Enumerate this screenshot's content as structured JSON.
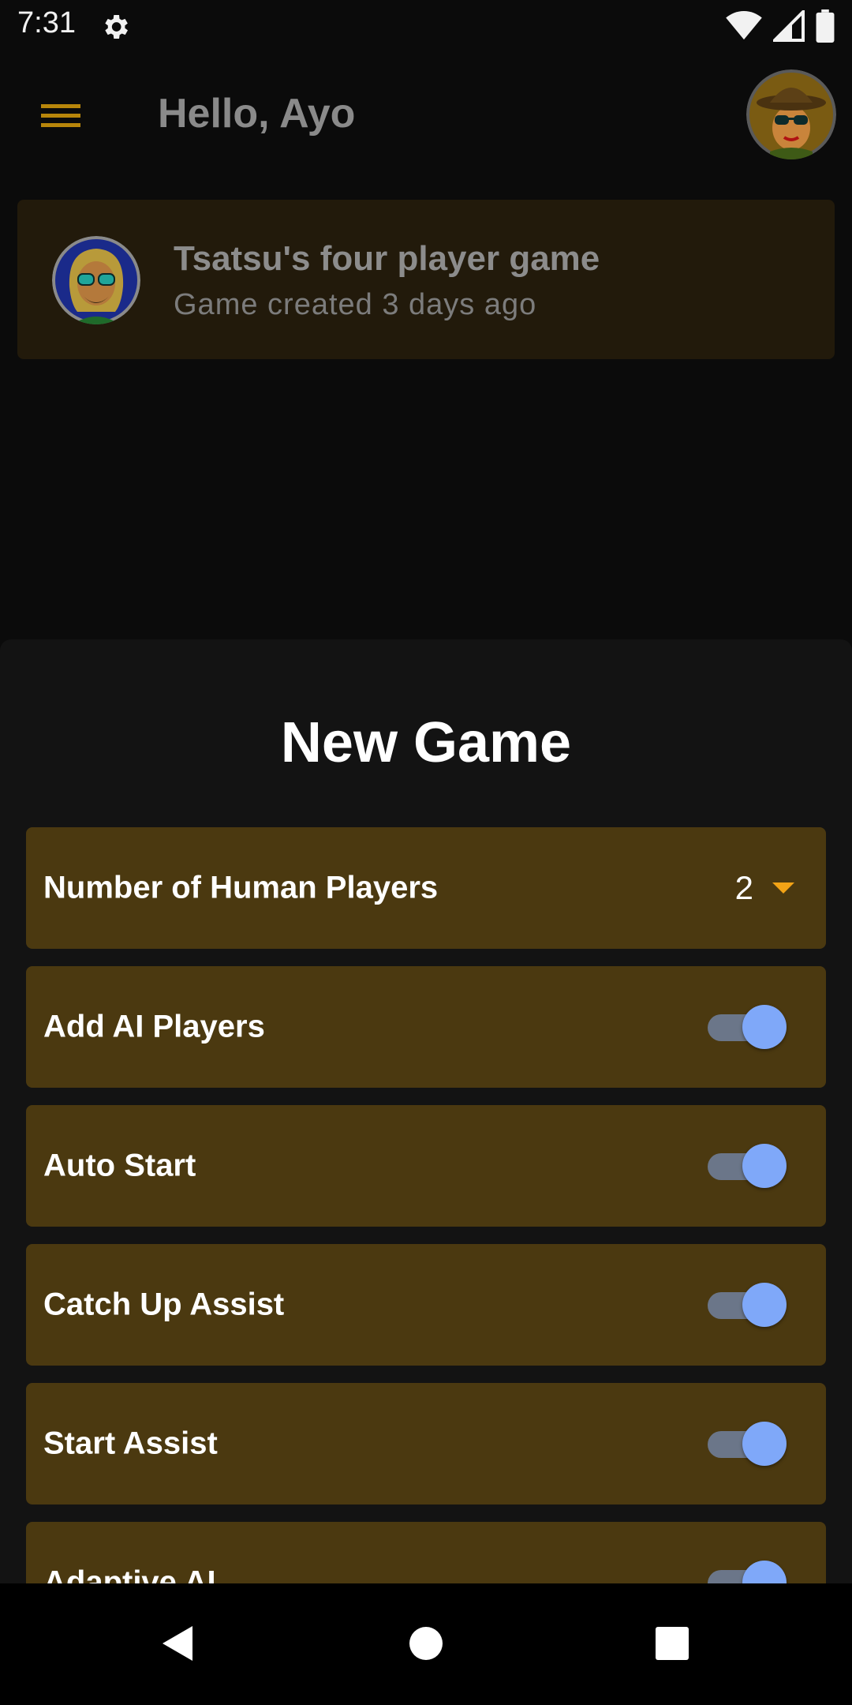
{
  "status_bar": {
    "time": "7:31",
    "icons": [
      "gear-icon",
      "wifi-icon",
      "signal-icon",
      "battery-icon"
    ]
  },
  "app_bar": {
    "title": "Hello, Ayo",
    "menu_icon": "hamburger-menu-icon",
    "accent_color": "#b8860b"
  },
  "game_card": {
    "title": "Tsatsu's four player game",
    "subtitle": "Game created 3 days ago"
  },
  "sheet": {
    "title": "New Game",
    "options": [
      {
        "label": "Number of Human Players",
        "type": "dropdown",
        "value": "2"
      },
      {
        "label": "Add AI Players",
        "type": "toggle",
        "on": true
      },
      {
        "label": "Auto Start",
        "type": "toggle",
        "on": true
      },
      {
        "label": "Catch Up Assist",
        "type": "toggle",
        "on": true
      },
      {
        "label": "Start Assist",
        "type": "toggle",
        "on": true
      },
      {
        "label": "Adaptive AI",
        "type": "toggle",
        "on": true
      }
    ]
  },
  "colors": {
    "option_bg": "#4b3910",
    "toggle_thumb": "#7fa8f9",
    "toggle_track": "#6b7689",
    "dropdown_arrow": "#f2a316"
  },
  "nav_bar": {
    "icons": [
      "back-icon",
      "home-icon",
      "recents-icon"
    ]
  }
}
